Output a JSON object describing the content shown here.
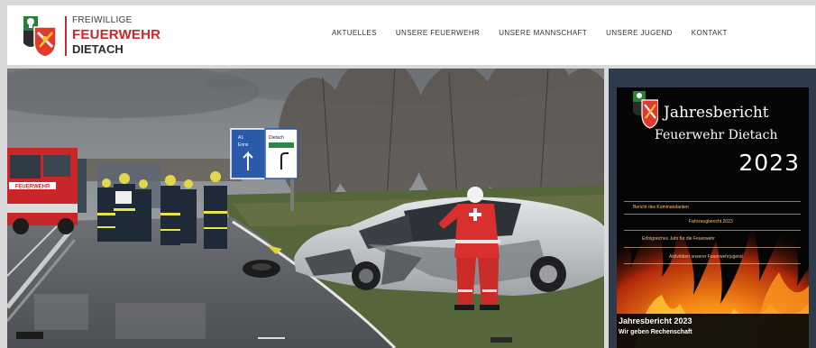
{
  "logo": {
    "line1": "FREIWILLIGE",
    "line2": "FEUERWEHR",
    "line3": "DIETACH",
    "crest_icon": "fire-brigade-crest-icon"
  },
  "nav": {
    "items": [
      {
        "label": "AKTUELLES"
      },
      {
        "label": "UNSERE FEUERWEHR"
      },
      {
        "label": "UNSERE MANNSCHAFT"
      },
      {
        "label": "UNSERE JUGEND"
      },
      {
        "label": "KONTAKT"
      }
    ]
  },
  "hero": {
    "truck_label": "FEUERWEHR",
    "sign_left": "Enns",
    "sign_left_code": "A1",
    "sign_right": "Dietach"
  },
  "report": {
    "title": "Jahresbericht",
    "subtitle": "Feuerwehr Dietach",
    "year": "2023",
    "toc": [
      "Bericht des Kommandanten",
      "Fahrzeugbericht 2023",
      "Erfolgreiches Jahr für die Feuerwehr",
      "Aktivitäten unserer Feuerwehrjugend"
    ],
    "caption_title": "Jahresbericht 2023",
    "caption_sub": "Wir geben Rechenschaft"
  },
  "colors": {
    "brand_red": "#d0242a",
    "panel_bg": "#2f3b4a",
    "header_bg": "#ffffff"
  }
}
